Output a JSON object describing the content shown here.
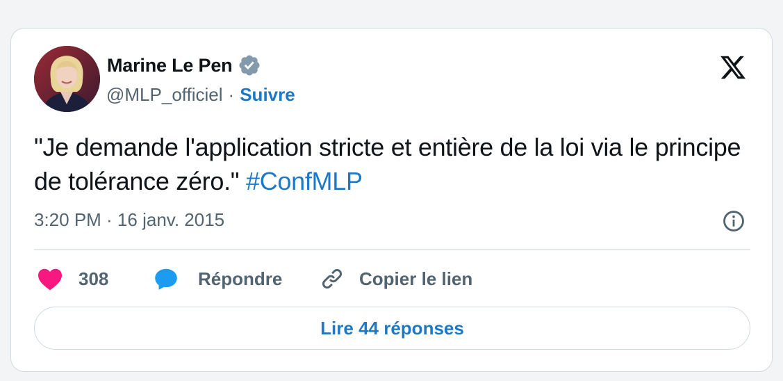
{
  "author": {
    "name": "Marine Le Pen",
    "handle": "@MLP_officiel",
    "separator": "·",
    "follow_label": "Suivre"
  },
  "tweet": {
    "text": "\"Je demande l'application stricte et entière de la loi via le principe de tolérance zéro.\" ",
    "hashtag": "#ConfMLP",
    "timestamp": "3:20 PM · 16 janv. 2015"
  },
  "actions": {
    "like_count": "308",
    "reply_label": "Répondre",
    "copy_link_label": "Copier le lien"
  },
  "read_replies_label": "Lire 44 réponses",
  "icons": {
    "brand": "x-logo-icon",
    "verified": "verified-badge-icon",
    "info": "info-icon",
    "like": "heart-icon",
    "reply": "speech-bubble-icon",
    "link": "link-icon"
  },
  "colors": {
    "accent": "#1d78c6",
    "like": "#f91880",
    "reply": "#1d9bf0",
    "verified": "#829aab",
    "text": "#0f1419",
    "muted": "#536471"
  }
}
